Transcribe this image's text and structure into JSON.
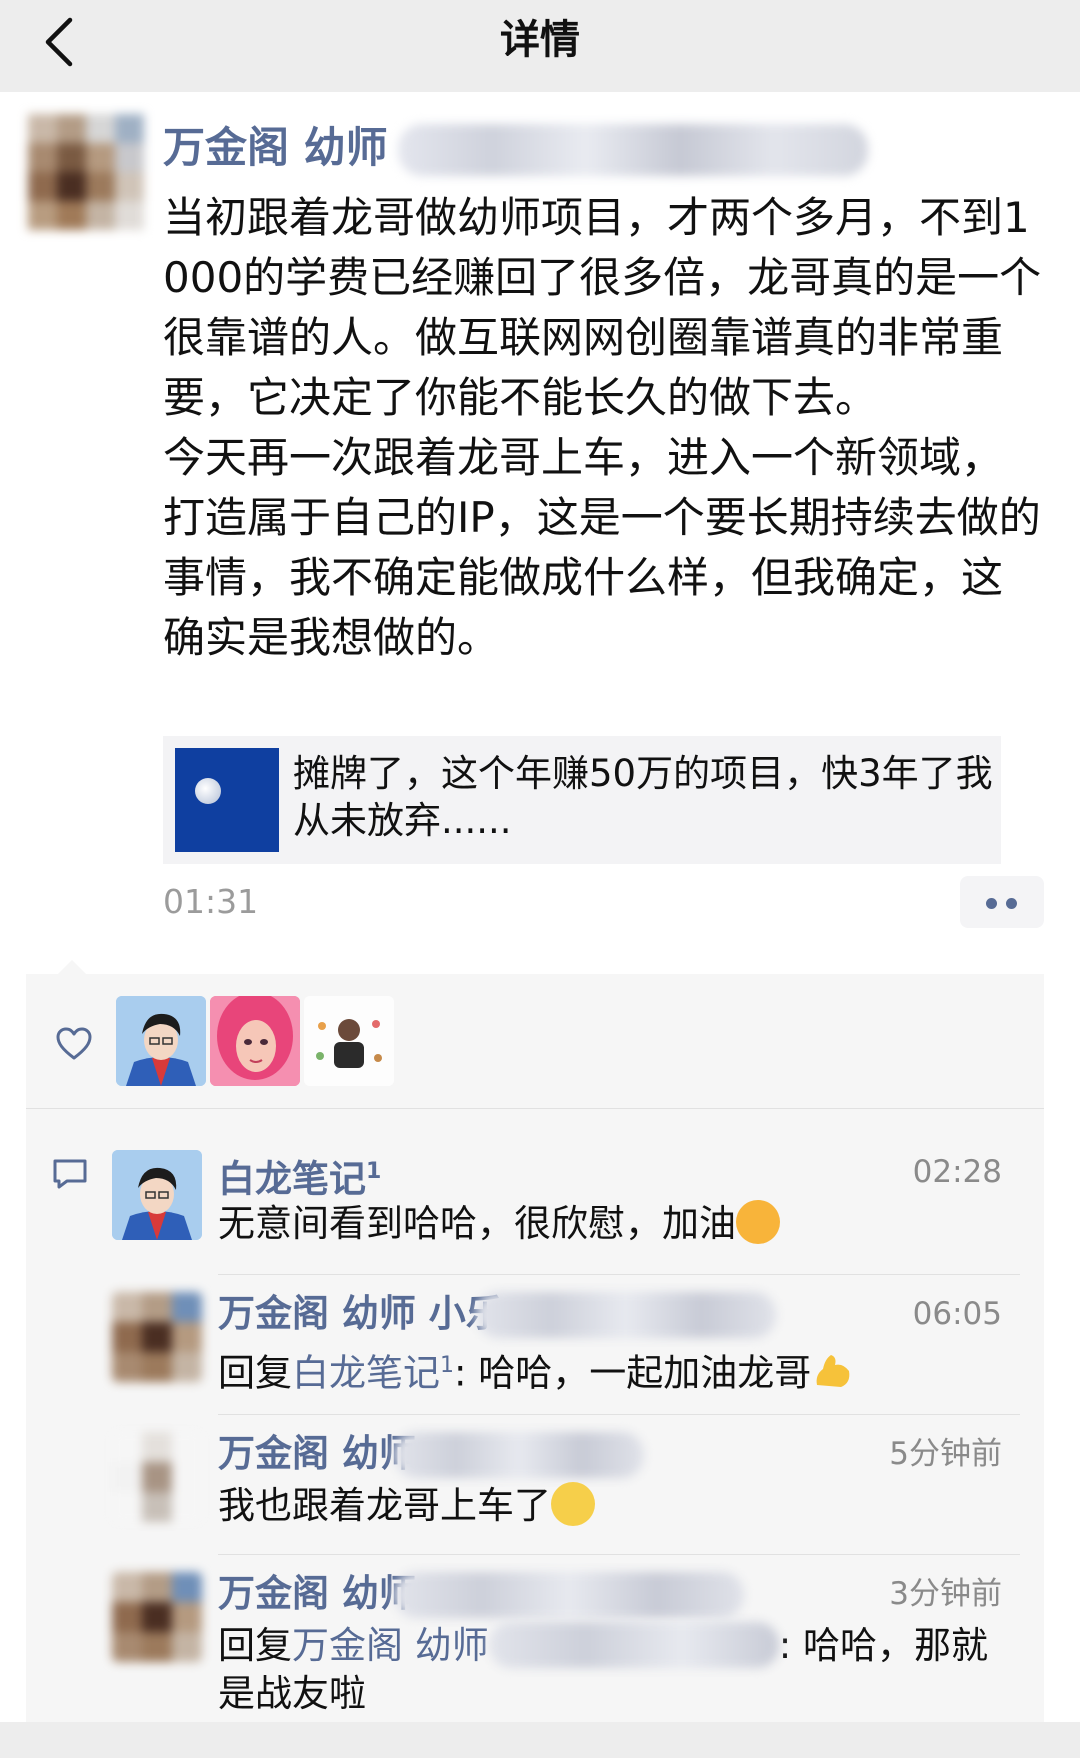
{
  "header": {
    "title": "详情",
    "back_icon": "chevron-left-icon"
  },
  "post": {
    "author_name": "万金阁 幼师",
    "text": "当初跟着龙哥做幼师项目，才两个多月，不到1000的学费已经赚回了很多倍，龙哥真的是一个很靠谱的人。做互联网网创圈靠谱真的非常重要，它决定了你能不能长久的做下去。\n今天再一次跟着龙哥上车，进入一个新领域，打造属于自己的IP，这是一个要长期持续去做的事情，我不确定能做成什么样，但我确定，这确实是我想做的。",
    "shared_link": {
      "title": "摊牌了，这个年赚50万的项目，快3年了我从未放弃......",
      "thumbnail": "moon-photo"
    },
    "time": "01:31",
    "more_icon": "more-dots-icon"
  },
  "likes": {
    "icon": "heart-icon",
    "avatars": [
      "liker-avatar-1",
      "liker-avatar-2",
      "liker-avatar-3"
    ]
  },
  "comments": {
    "icon": "comment-icon",
    "items": [
      {
        "name": "白龙笔记",
        "badge": "1",
        "time": "02:28",
        "text": "无意间看到哈哈，很欣慰，加油",
        "emoji": "fist-face-emoji"
      },
      {
        "name": "万金阁 幼师 小乐",
        "time": "06:05",
        "reply_prefix": "回复",
        "reply_to": "白龙笔记",
        "reply_badge": "1",
        "text": ": 哈哈，一起加油龙哥",
        "emoji": "flexed-biceps-emoji"
      },
      {
        "name": "万金阁 幼师",
        "time": "5分钟前",
        "text": "我也跟着龙哥上车了",
        "emoji": "thinking-face-emoji"
      },
      {
        "name": "万金阁 幼师",
        "time": "3分钟前",
        "reply_prefix": "回复",
        "reply_to": "万金阁 幼师",
        "text_line1": ": 哈哈，那就",
        "text_line2": "是战友啦"
      }
    ]
  },
  "colors": {
    "link_blue": "#576b95",
    "header_bg": "#ededed",
    "interaction_bg": "#f6f6f6"
  }
}
